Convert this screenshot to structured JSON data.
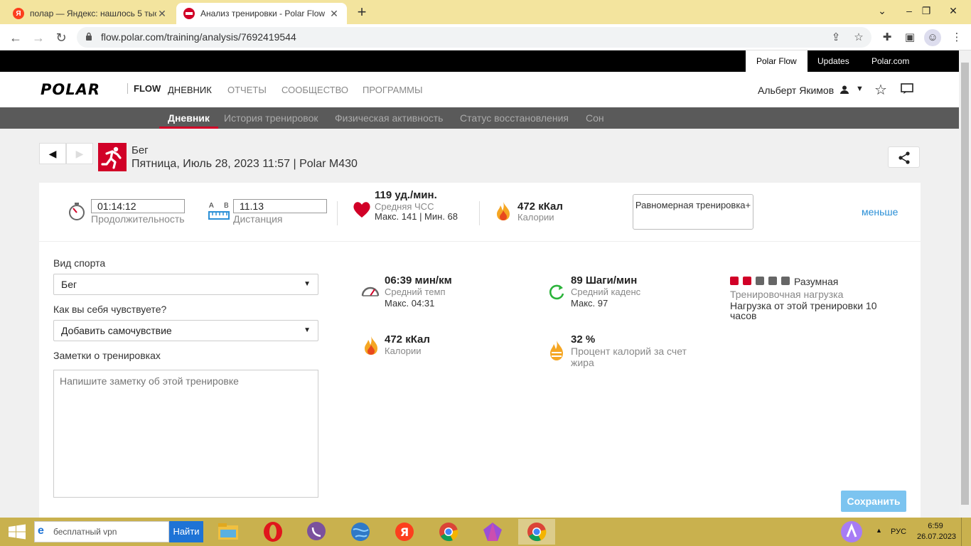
{
  "browser": {
    "tabs": [
      {
        "title": "полар — Яндекс: нашлось 5 тыс",
        "favicon": "yandex-icon",
        "active": false
      },
      {
        "title": "Анализ тренировки - Polar Flow",
        "favicon": "polar-icon",
        "active": true
      }
    ],
    "new_tab": "+",
    "url": "flow.polar.com/training/analysis/7692419544"
  },
  "polar": {
    "top_links": [
      "Polar Flow",
      "Updates",
      "Polar.com"
    ],
    "logo": "POLAR",
    "brand": "FLOW",
    "main_nav": [
      "ДНЕВНИК",
      "ОТЧЕТЫ",
      "СООБЩЕСТВО",
      "ПРОГРАММЫ"
    ],
    "user_name": "Альберт Якимов",
    "sub_nav": [
      "Дневник",
      "История тренировок",
      "Физическая активность",
      "Статус восстановления",
      "Сон"
    ]
  },
  "session": {
    "sport": "Бег",
    "date_line": "Пятница, Июль 28, 2023 11:57 | Polar M430"
  },
  "summary": {
    "duration_value": "01:14:12",
    "duration_label": "Продолжительность",
    "distance_ab_a": "A",
    "distance_ab_b": "B",
    "distance_value": "11.13",
    "distance_label": "Дистанция",
    "hr_value": "119 уд./мин.",
    "hr_label": "Средняя ЧСС",
    "hr_minmax": "Макс. 141  |  Мин. 68",
    "calories_value": "472 кКал",
    "calories_label": "Калории",
    "mode_button": "Равномерная тренировка+",
    "less_link": "меньше"
  },
  "form": {
    "sport_label": "Вид спорта",
    "sport_value": "Бег",
    "feeling_label": "Как вы себя чувствуете?",
    "feeling_value": "Добавить самочувствие",
    "notes_label": "Заметки о тренировках",
    "notes_placeholder": "Напишите заметку об этой тренировке",
    "save_button": "Сохранить"
  },
  "stats": {
    "pace_value": "06:39 мин/км",
    "pace_label": "Средний темп",
    "pace_max": "Макс. 04:31",
    "cadence_value": "89 Шаги/мин",
    "cadence_label": "Средний каденс",
    "cadence_max": "Макс. 97",
    "load_level": "Разумная",
    "load_label": "Тренировочная нагрузка",
    "load_desc": "Нагрузка от этой тренировки 10 часов",
    "load_filled": 2,
    "load_total": 5,
    "cal_value": "472 кКал",
    "cal_label": "Калории",
    "fat_value": "32 %",
    "fat_label": "Процент калорий за счет жира"
  },
  "taskbar": {
    "search_value": "бесплатный vpn",
    "search_button": "Найти",
    "apps": [
      "file-explorer-icon",
      "opera-icon",
      "viber-icon",
      "browser-globe-icon",
      "yandex-browser-icon",
      "chrome-icon",
      "crystal-icon",
      "chrome-active-icon"
    ],
    "lang": "РУС",
    "time": "6:59",
    "date": "26.07.2023"
  },
  "colors": {
    "polar_red": "#d10027",
    "link_blue": "#2a8fd6",
    "save_blue": "#7cc4f0",
    "load_active": "#d10027",
    "load_inactive": "#666666"
  }
}
